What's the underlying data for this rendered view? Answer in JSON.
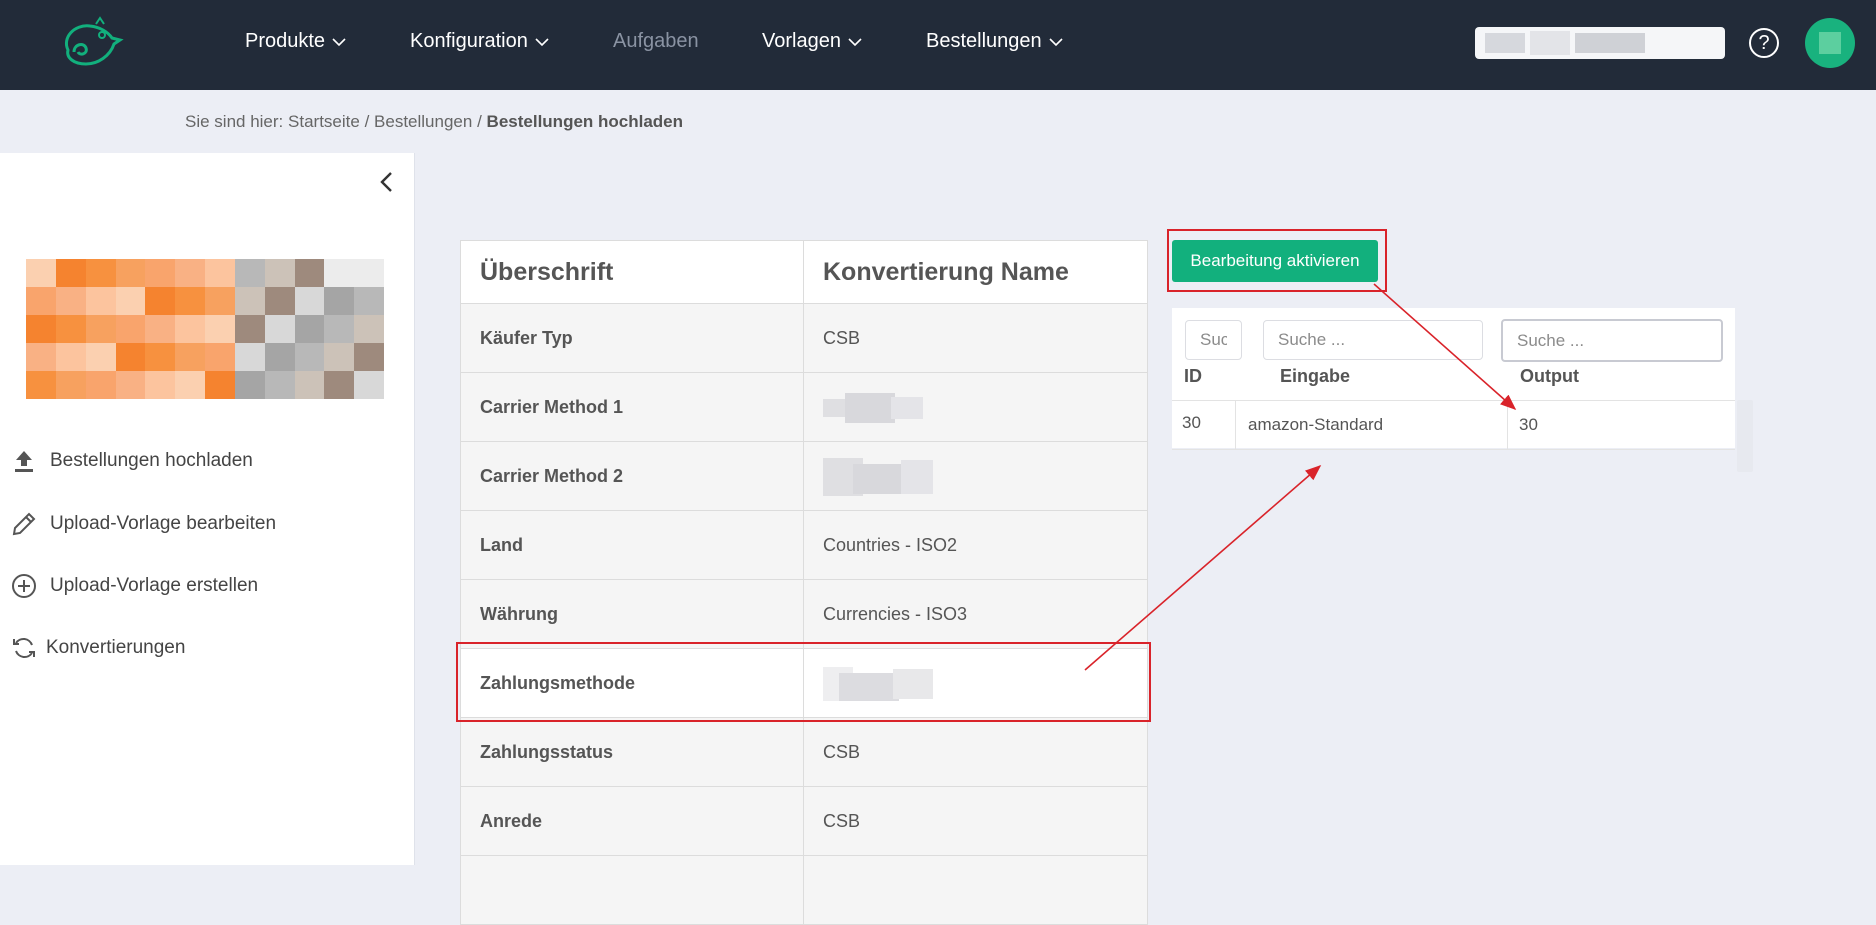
{
  "topnav": {
    "items": [
      {
        "label": "Produkte",
        "dropdown": true
      },
      {
        "label": "Konfiguration",
        "dropdown": true
      },
      {
        "label": "Aufgaben",
        "dropdown": false
      },
      {
        "label": "Vorlagen",
        "dropdown": true
      },
      {
        "label": "Bestellungen",
        "dropdown": true
      }
    ],
    "help_label": "?",
    "icons": [
      "chameleon-logo-icon",
      "chevron-down-icon",
      "help-icon",
      "user-avatar"
    ]
  },
  "breadcrumb": {
    "prefix": "Sie sind hier:",
    "home": "Startseite",
    "sep": "/",
    "parent": "Bestellungen",
    "current": "Bestellungen hochladen"
  },
  "sidebar": {
    "items": [
      {
        "label": "Bestellungen hochladen",
        "icon": "upload-icon"
      },
      {
        "label": "Upload-Vorlage bearbeiten",
        "icon": "pencil-icon"
      },
      {
        "label": "Upload-Vorlage erstellen",
        "icon": "plus-circle-icon"
      },
      {
        "label": "Konvertierungen",
        "icon": "refresh-icon"
      }
    ]
  },
  "conversion_table": {
    "headers": [
      "Überschrift",
      "Konvertierung Name"
    ],
    "rows": [
      {
        "key": "Käufer Typ",
        "value": "CSB"
      },
      {
        "key": "Carrier Method 1",
        "value": ""
      },
      {
        "key": "Carrier Method 2",
        "value": ""
      },
      {
        "key": "Land",
        "value": "Countries - ISO2"
      },
      {
        "key": "Währung",
        "value": "Currencies - ISO3"
      },
      {
        "key": "Zahlungsmethode",
        "value": ""
      },
      {
        "key": "Zahlungsstatus",
        "value": "CSB"
      },
      {
        "key": "Anrede",
        "value": "CSB"
      }
    ]
  },
  "conversion_detail": {
    "activate_button": "Bearbeitung aktivieren",
    "filters": {
      "id_placeholder": "Suche ...",
      "input_placeholder": "Suche ...",
      "output_placeholder": "Suche ..."
    },
    "columns": [
      "ID",
      "Eingabe",
      "Output"
    ],
    "rows": [
      {
        "id": "30",
        "input": "amazon-Standard",
        "output": "30"
      }
    ]
  },
  "colors": {
    "topbar": "#222b39",
    "accent_green": "#12b07d",
    "annotation_red": "#d9232a",
    "page_background": "#eceef5"
  }
}
